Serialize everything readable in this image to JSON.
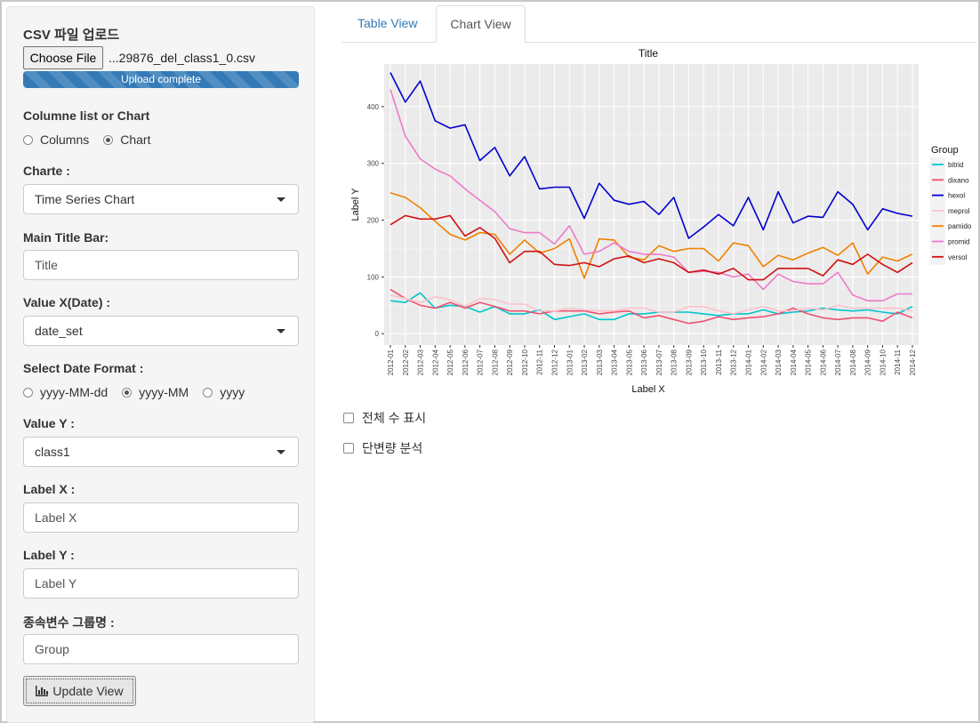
{
  "sidebar": {
    "upload_label": "CSV 파일 업로드",
    "choose_file": "Choose File",
    "file_name": "...29876_del_class1_0.csv",
    "upload_status": "Upload complete",
    "mode_label": "Columne list or Chart",
    "mode_options": [
      "Columns",
      "Chart"
    ],
    "mode_selected": "Chart",
    "chart_label": "Charte :",
    "chart_value": "Time Series Chart",
    "title_label": "Main Title Bar:",
    "title_value": "Title",
    "x_label": "Value X(Date) :",
    "x_value": "date_set",
    "date_format_label": "Select Date Format :",
    "date_formats": [
      "yyyy-MM-dd",
      "yyyy-MM",
      "yyyy"
    ],
    "date_format_selected": "yyyy-MM",
    "y_label": "Value Y :",
    "y_value": "class1",
    "labelx_label": "Label X :",
    "labelx_value": "Label X",
    "labely_label": "Label Y :",
    "labely_value": "Label Y",
    "group_label": "종속변수 그룹명 :",
    "group_value": "Group",
    "update_button": "Update View"
  },
  "tabs": [
    "Table View",
    "Chart View"
  ],
  "active_tab": "Chart View",
  "checkboxes": [
    "전체 수 표시",
    "단변량 분석"
  ],
  "colors": {
    "bitrid": "#00c5cd",
    "dixano": "#f0506e",
    "hexol": "#0000cd",
    "meprol": "#ffc0cb",
    "pamido": "#f08000",
    "promid": "#ee7ac8",
    "versol": "#d01010"
  },
  "chart_data": {
    "type": "line",
    "title": "Title",
    "xlabel": "Label X",
    "ylabel": "Label Y",
    "legend_title": "Group",
    "legend_position": "right",
    "ylim": [
      -20,
      475
    ],
    "yticks": [
      0,
      100,
      200,
      300,
      400
    ],
    "grid": true,
    "x": [
      "2012-01",
      "2012-02",
      "2012-03",
      "2012-04",
      "2012-05",
      "2012-06",
      "2012-07",
      "2012-08",
      "2012-09",
      "2012-10",
      "2012-11",
      "2012-12",
      "2013-01",
      "2013-02",
      "2013-03",
      "2013-04",
      "2013-05",
      "2013-06",
      "2013-07",
      "2013-08",
      "2013-09",
      "2013-10",
      "2013-11",
      "2013-12",
      "2014-01",
      "2014-02",
      "2014-03",
      "2014-04",
      "2014-05",
      "2014-06",
      "2014-07",
      "2014-08",
      "2014-09",
      "2014-10",
      "2014-11",
      "2014-12"
    ],
    "series": [
      {
        "name": "bitrid",
        "values": [
          58,
          55,
          72,
          45,
          50,
          48,
          38,
          48,
          35,
          35,
          42,
          25,
          30,
          35,
          25,
          25,
          35,
          35,
          38,
          38,
          38,
          35,
          32,
          35,
          35,
          42,
          35,
          38,
          40,
          45,
          42,
          40,
          42,
          38,
          35,
          48
        ]
      },
      {
        "name": "dixano",
        "values": [
          78,
          62,
          50,
          45,
          55,
          45,
          55,
          48,
          40,
          40,
          35,
          40,
          40,
          40,
          35,
          38,
          40,
          28,
          32,
          25,
          18,
          22,
          30,
          25,
          28,
          30,
          35,
          45,
          35,
          28,
          25,
          28,
          28,
          22,
          38,
          28
        ]
      },
      {
        "name": "hexol",
        "values": [
          460,
          408,
          445,
          375,
          362,
          368,
          305,
          328,
          278,
          312,
          255,
          258,
          258,
          203,
          265,
          235,
          228,
          233,
          210,
          240,
          168,
          188,
          210,
          190,
          240,
          183,
          250,
          195,
          207,
          205,
          250,
          228,
          183,
          220,
          212,
          207
        ]
      },
      {
        "name": "meprol",
        "values": [
          68,
          62,
          55,
          65,
          60,
          48,
          62,
          60,
          52,
          52,
          40,
          40,
          45,
          42,
          40,
          40,
          45,
          45,
          38,
          38,
          48,
          48,
          40,
          35,
          42,
          48,
          40,
          40,
          45,
          42,
          50,
          45,
          45,
          45,
          45,
          40
        ]
      },
      {
        "name": "pamido",
        "values": [
          248,
          240,
          222,
          198,
          175,
          165,
          178,
          175,
          140,
          165,
          142,
          150,
          167,
          98,
          167,
          165,
          135,
          130,
          155,
          145,
          150,
          150,
          128,
          160,
          155,
          118,
          138,
          130,
          142,
          152,
          138,
          160,
          105,
          135,
          128,
          140
        ]
      },
      {
        "name": "promid",
        "values": [
          430,
          348,
          308,
          290,
          278,
          255,
          235,
          215,
          185,
          178,
          178,
          158,
          190,
          140,
          145,
          160,
          145,
          140,
          140,
          135,
          108,
          110,
          108,
          100,
          105,
          78,
          105,
          92,
          88,
          88,
          108,
          68,
          58,
          58,
          70,
          70
        ]
      },
      {
        "name": "versol",
        "values": [
          192,
          208,
          202,
          202,
          208,
          172,
          187,
          168,
          125,
          145,
          145,
          122,
          120,
          125,
          118,
          132,
          137,
          125,
          132,
          125,
          108,
          112,
          105,
          115,
          95,
          95,
          115,
          115,
          115,
          102,
          130,
          122,
          140,
          122,
          108,
          125
        ]
      }
    ]
  }
}
